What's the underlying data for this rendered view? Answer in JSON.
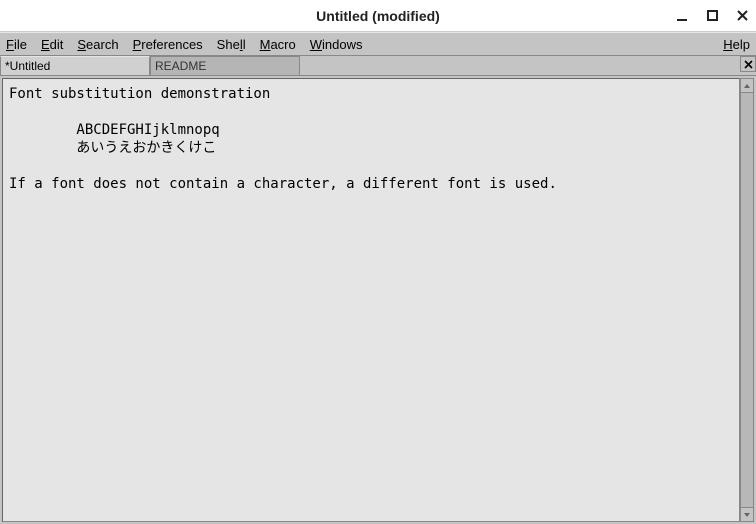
{
  "window": {
    "title": "Untitled (modified)"
  },
  "menu": {
    "file": "File",
    "edit": "Edit",
    "search": "Search",
    "preferences": "Preferences",
    "shell": "Shell",
    "macro": "Macro",
    "windows": "Windows",
    "help": "Help"
  },
  "tabs": {
    "t0": "*Untitled",
    "t1": "README"
  },
  "editor": {
    "content": "Font substitution demonstration\n\n        ABCDEFGHIjklmnopq\n        あいうえおかきくけこ\n\nIf a font does not contain a character, a different font is used."
  }
}
